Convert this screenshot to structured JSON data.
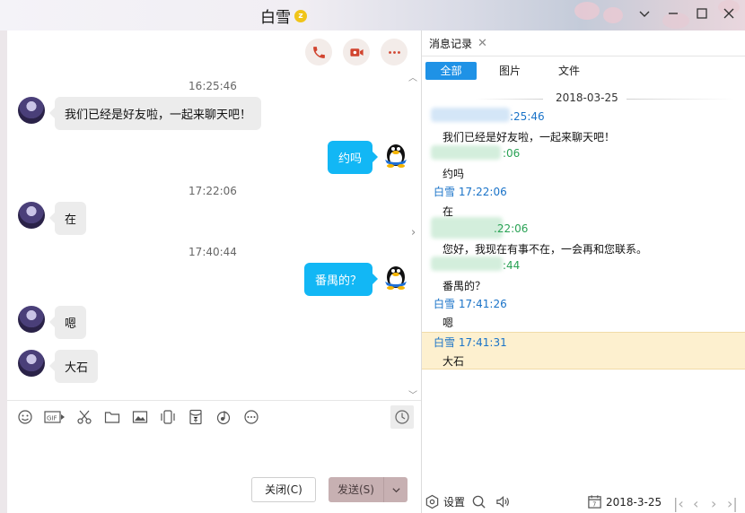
{
  "window": {
    "title": "白雪",
    "title_badge": "z"
  },
  "chat": {
    "messages": [
      {
        "kind": "time",
        "text": "16:25:46"
      },
      {
        "kind": "in",
        "text": "我们已经是好友啦，一起来聊天吧！"
      },
      {
        "kind": "out",
        "text": "约吗"
      },
      {
        "kind": "time",
        "text": "17:22:06"
      },
      {
        "kind": "in",
        "text": "在"
      },
      {
        "kind": "time",
        "text": "17:40:44"
      },
      {
        "kind": "out",
        "text": "番禺的？"
      },
      {
        "kind": "in",
        "text": "嗯"
      },
      {
        "kind": "in",
        "text": "大石"
      }
    ],
    "call_icons": [
      "phone-icon",
      "video-icon",
      "more-icon"
    ],
    "toolbar_icons": [
      "emoji-icon",
      "gif-icon",
      "scissors-icon",
      "folder-icon",
      "image-icon",
      "shake-icon",
      "red-packet-icon",
      "music-icon",
      "more-icon"
    ],
    "close_label": "关闭(C)",
    "send_label": "发送(S)"
  },
  "history": {
    "tab_label": "消息记录",
    "filters": [
      "全部",
      "图片",
      "文件"
    ],
    "date": "2018-03-25",
    "entries": [
      {
        "name": ":25:46",
        "color": "blue",
        "text": "我们已经是好友啦，一起来聊天吧！"
      },
      {
        "name": ":06",
        "color": "green",
        "text": "约吗"
      },
      {
        "name": "白雪 17:22:06",
        "color": "blue",
        "text": "在"
      },
      {
        "name": ".22:06",
        "color": "green",
        "text": "您好，我现在有事不在，一会再和您联系。"
      },
      {
        "name": ":44",
        "color": "green",
        "text": "番禺的？"
      },
      {
        "name": "白雪 17:41:26",
        "color": "blue",
        "text": "嗯"
      },
      {
        "name": "白雪 17:41:31",
        "color": "blue",
        "text": "大石"
      }
    ],
    "footer": {
      "settings": "设置",
      "date": "2018-3-25"
    }
  },
  "colors": {
    "accent": "#12b7f5",
    "filter_active": "#1f92e6",
    "highlight": "#fdf0cf"
  }
}
